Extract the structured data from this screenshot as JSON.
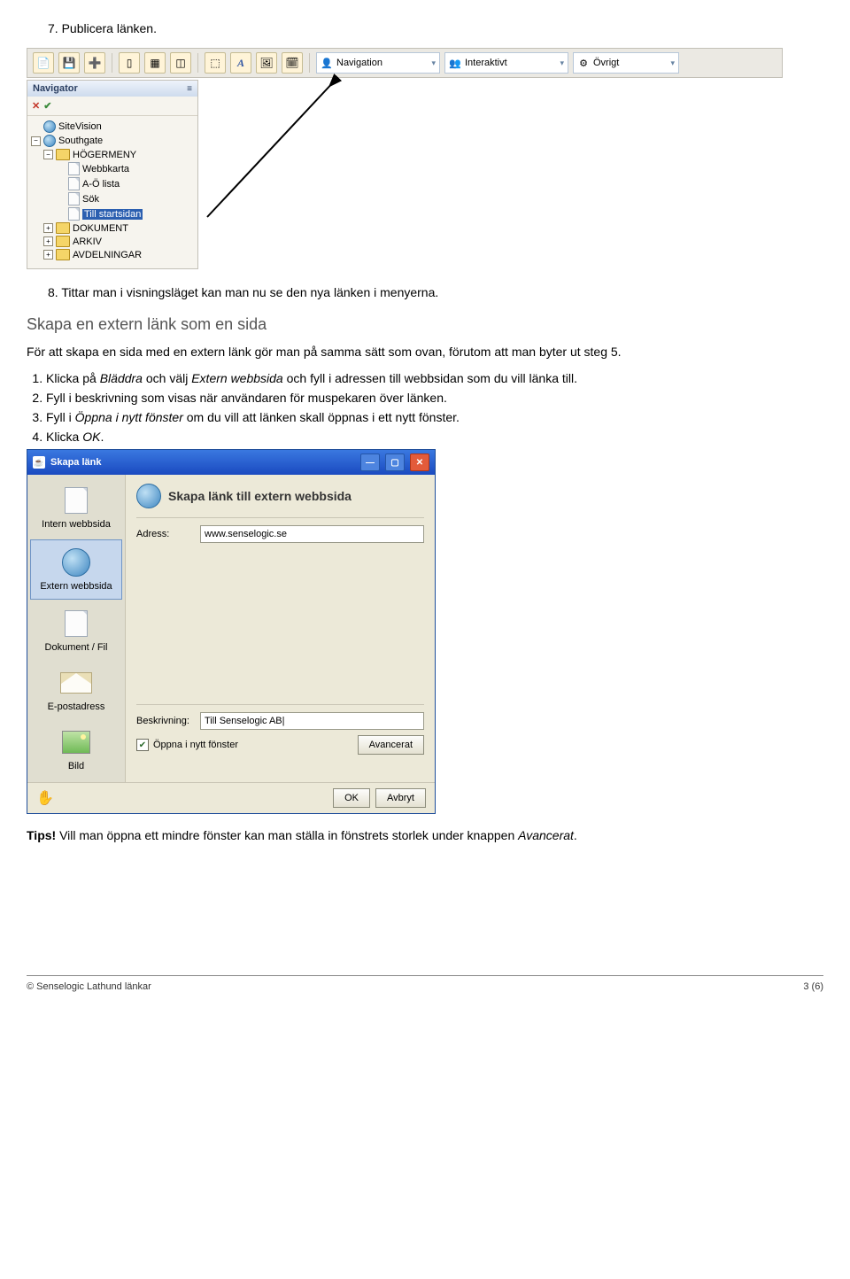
{
  "step7": {
    "num": "7.",
    "text": "Publicera länken."
  },
  "step8": {
    "num": "8.",
    "text": "Tittar man i visningsläget kan man nu se den nya länken i menyerna."
  },
  "section_title": "Skapa en extern länk som en sida",
  "intro": "För att skapa en sida med en extern länk gör man på samma sätt som ovan, förutom att man byter ut steg 5.",
  "list": [
    {
      "pre": "Klicka på ",
      "it1": "Bläddra",
      "mid1": " och välj ",
      "it2": "Extern webbsida",
      "mid2": " och fyll i adressen till webbsidan som du vill länka till."
    },
    {
      "text": "Fyll i beskrivning som visas när användaren för muspekaren över länken."
    },
    {
      "pre": "Fyll i ",
      "it1": "Öppna i nytt fönster",
      "mid1": " om du vill att länken skall öppnas i ett nytt fönster."
    },
    {
      "pre": "Klicka ",
      "it1": "OK",
      "mid1": "."
    }
  ],
  "toolbar": {
    "nav_label": "Navigation",
    "inter_label": "Interaktivt",
    "ovrigt_label": "Övrigt"
  },
  "navigator": {
    "title": "Navigator",
    "items": {
      "root": "SiteVision",
      "southgate": "Southgate",
      "hoger": "HÖGERMENY",
      "webbkarta": "Webbkarta",
      "aolista": "A-Ö lista",
      "sok": "Sök",
      "tillstart": "Till startsidan",
      "dokument": "DOKUMENT",
      "arkiv": "ARKIV",
      "avdel": "AVDELNINGAR"
    }
  },
  "dialog": {
    "title": "Skapa länk",
    "heading": "Skapa länk till extern webbsida",
    "side": {
      "intern": "Intern webbsida",
      "extern": "Extern webbsida",
      "dok": "Dokument / Fil",
      "epost": "E-postadress",
      "bild": "Bild"
    },
    "adress_label": "Adress:",
    "adress_value": "www.senselogic.se",
    "beskr_label": "Beskrivning:",
    "beskr_value": "Till Senselogic AB|",
    "open_new": "Öppna i nytt fönster",
    "advanced": "Avancerat",
    "ok": "OK",
    "cancel": "Avbryt"
  },
  "tips": {
    "bold": "Tips!",
    "text": " Vill man öppna ett mindre fönster kan man ställa in fönstrets storlek under knappen ",
    "it": "Avancerat",
    "end": "."
  },
  "footer": {
    "left": "© Senselogic Lathund länkar",
    "right": "3 (6)"
  }
}
